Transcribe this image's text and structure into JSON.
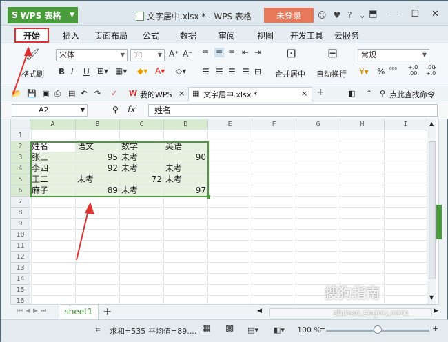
{
  "window": {
    "app_label": "WPS 表格",
    "doc_title": "文字居中.xlsx * - WPS 表格",
    "login_label": "未登录",
    "toolbar_glyphs": [
      "⟲",
      "♥",
      "?",
      "⌄"
    ]
  },
  "ribbon_tabs": [
    "开始",
    "插入",
    "页面布局",
    "公式",
    "数据",
    "审阅",
    "视图",
    "开发工具",
    "云服务"
  ],
  "ribbon": {
    "format_painter": "格式刷",
    "font_name": "宋体",
    "font_size": "11",
    "grow": "A⁺",
    "shrink": "A⁻",
    "bold": "B",
    "italic": "I",
    "underline": "U",
    "merge_center": "合并居中",
    "wrap_text": "自动换行",
    "number_format": "常规",
    "percent": "%",
    "comma": "⁰⁰⁰",
    "inc_decimal": "+.0 .00",
    "dec_decimal": ".00 +.0"
  },
  "doc_tabs": {
    "my_wps": "我的WPS",
    "active_file": "文字居中.xlsx *",
    "add": "+",
    "help": "点此查找命令"
  },
  "formula_bar": {
    "cell_ref": "A2",
    "fx": "fx",
    "content": "姓名"
  },
  "columns": [
    "A",
    "B",
    "C",
    "D",
    "E",
    "F",
    "G",
    "H",
    "I"
  ],
  "rows": [
    "1",
    "2",
    "3",
    "4",
    "5",
    "6",
    "7",
    "8",
    "9",
    "10",
    "11",
    "12",
    "13",
    "14",
    "15",
    "16"
  ],
  "table": {
    "headers": [
      "姓名",
      "语文",
      "数学",
      "英语"
    ],
    "rows": [
      [
        "张三",
        "95",
        "未考",
        "90"
      ],
      [
        "李四",
        "92",
        "未考",
        "未考"
      ],
      [
        "王二",
        "未考",
        "72",
        "未考"
      ],
      [
        "麻子",
        "89",
        "未考",
        "97"
      ]
    ]
  },
  "sheets": {
    "active": "sheet1",
    "add": "+"
  },
  "status": {
    "sum": "求和=535",
    "avg": "平均值=89....",
    "zoom": "100 %",
    "zoom_level": 0.5
  },
  "watermark": {
    "main": "搜狗指南",
    "sub": "zhinan.sogou.com"
  },
  "colors": {
    "accent": "#4a9b3c",
    "highlight": "#e03030",
    "login": "#e8785a"
  }
}
